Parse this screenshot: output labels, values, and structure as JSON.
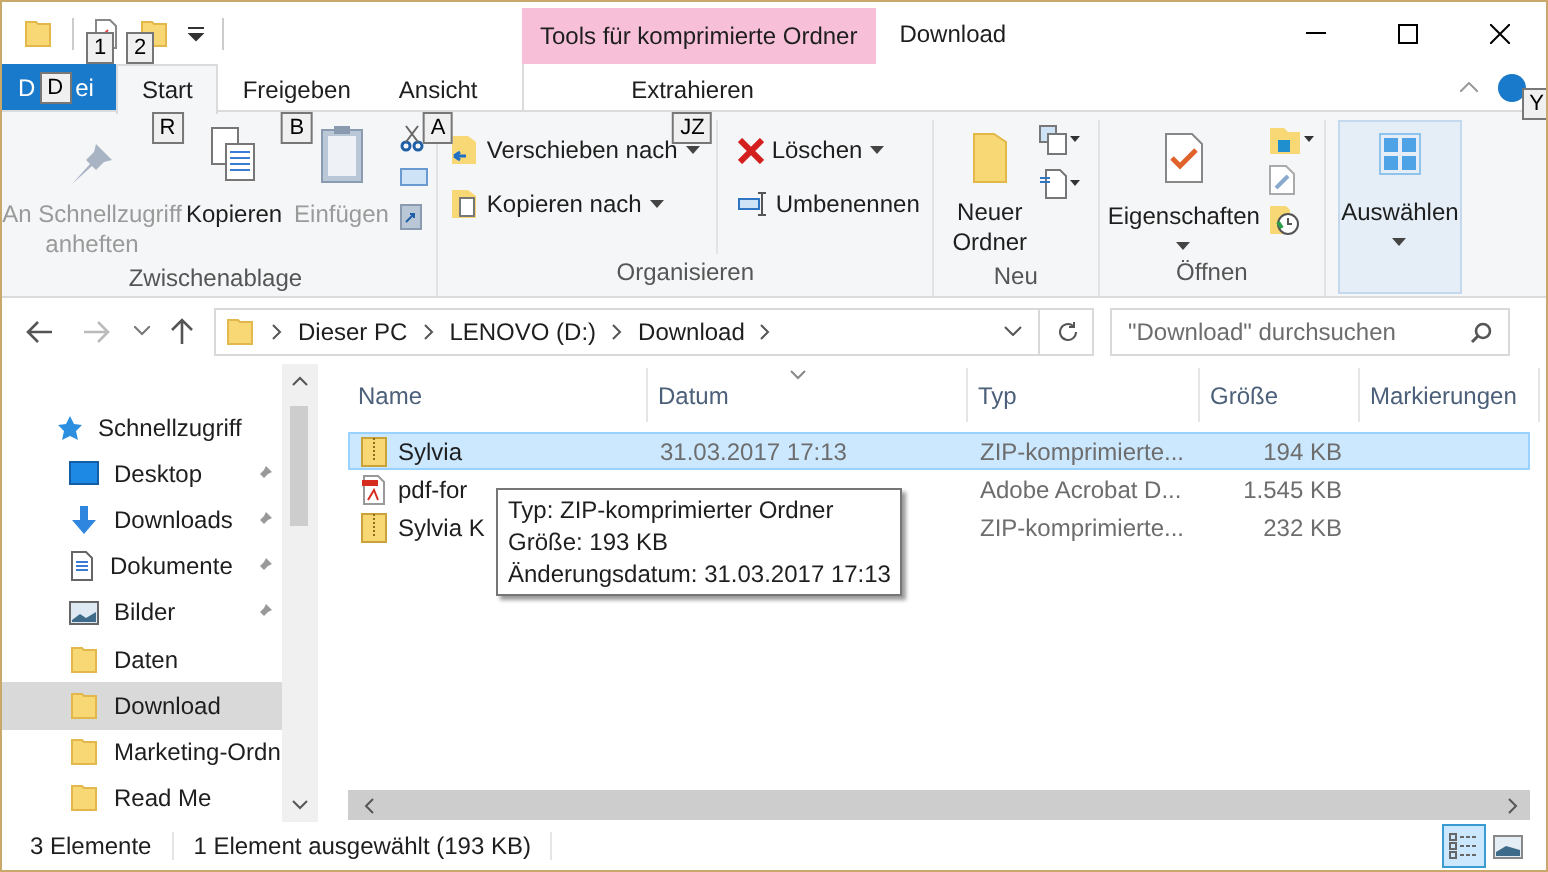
{
  "quick_access_toolbar": {
    "key_tips": [
      "1",
      "2"
    ]
  },
  "context_tab_group": {
    "label": "Tools für komprimierte Ordner"
  },
  "window": {
    "title": "Download"
  },
  "file_tab": {
    "label_start": "D",
    "key_tip": "D",
    "label_end": "ei"
  },
  "tabs": [
    {
      "label": "Start",
      "key_tip": "R",
      "selected": true
    },
    {
      "label": "Freigeben",
      "key_tip": "B",
      "selected": false
    },
    {
      "label": "Ansicht",
      "key_tip": "A",
      "selected": false
    },
    {
      "label": "Extrahieren",
      "key_tip": "JZ",
      "selected": false
    }
  ],
  "help_key_tip": "Y",
  "ribbon": {
    "groups": [
      {
        "label": "Zwischenablage",
        "buttons": [
          {
            "label": "An Schnellzugriff anheften",
            "disabled": true
          },
          {
            "label": "Kopieren",
            "disabled": false
          },
          {
            "label": "Einfügen",
            "disabled": true
          }
        ]
      },
      {
        "label": "Organisieren",
        "buttons": [
          {
            "label": "Verschieben nach",
            "disabled": false
          },
          {
            "label": "Kopieren nach",
            "disabled": false
          },
          {
            "label": "Löschen",
            "disabled": false
          },
          {
            "label": "Umbenennen",
            "disabled": false
          }
        ]
      },
      {
        "label": "Neu",
        "buttons": [
          {
            "label": "Neuer Ordner",
            "disabled": false
          }
        ]
      },
      {
        "label": "Öffnen",
        "buttons": [
          {
            "label": "Eigenschaften",
            "disabled": false
          }
        ]
      },
      {
        "buttons": [
          {
            "label": "Auswählen",
            "disabled": false
          }
        ]
      }
    ]
  },
  "address_bar": {
    "crumbs": [
      "Dieser PC",
      "LENOVO (D:)",
      "Download"
    ]
  },
  "search": {
    "placeholder": "\"Download\" durchsuchen"
  },
  "sidebar": {
    "items": [
      {
        "label": "Schnellzugriff",
        "kind": "star",
        "selected": false,
        "children": [
          {
            "label": "Desktop",
            "kind": "desktop",
            "pinned": true,
            "selected": false
          },
          {
            "label": "Downloads",
            "kind": "download",
            "pinned": true,
            "selected": false
          },
          {
            "label": "Dokumente",
            "kind": "document",
            "pinned": true,
            "selected": false
          },
          {
            "label": "Bilder",
            "kind": "image",
            "pinned": true,
            "selected": false
          },
          {
            "label": "Daten",
            "kind": "folder",
            "pinned": false,
            "selected": false
          },
          {
            "label": "Download",
            "kind": "folder",
            "pinned": false,
            "selected": true
          },
          {
            "label": "Marketing-Ordn",
            "kind": "folder",
            "pinned": false,
            "selected": false
          },
          {
            "label": "Read Me",
            "kind": "folder",
            "pinned": false,
            "selected": false
          }
        ]
      }
    ]
  },
  "table": {
    "columns": [
      "Name",
      "Datum",
      "Typ",
      "Größe",
      "Markierungen"
    ],
    "rows": [
      {
        "kind": "zip",
        "name": "Sylvia",
        "date": "31.03.2017 17:13",
        "type": "ZIP-komprimierte...",
        "size": "194 KB",
        "selected": true
      },
      {
        "kind": "pdf",
        "name": "pdf-for",
        "type": "Adobe Acrobat D...",
        "size": "1.545 KB",
        "selected": false
      },
      {
        "kind": "zip",
        "name": "Sylvia K",
        "type": "ZIP-komprimierte...",
        "size": "232 KB",
        "selected": false
      }
    ]
  },
  "tooltip": {
    "lines": [
      "Typ: ZIP-komprimierter Ordner",
      "Größe: 193 KB",
      "Änderungsdatum: 31.03.2017 17:13"
    ]
  },
  "status_bar": {
    "item_count": "3 Elemente",
    "selection": "1 Element ausgewählt (193 KB)",
    "views": [
      {
        "kind": "details",
        "selected": true
      },
      {
        "kind": "tiles",
        "selected": false
      }
    ]
  }
}
